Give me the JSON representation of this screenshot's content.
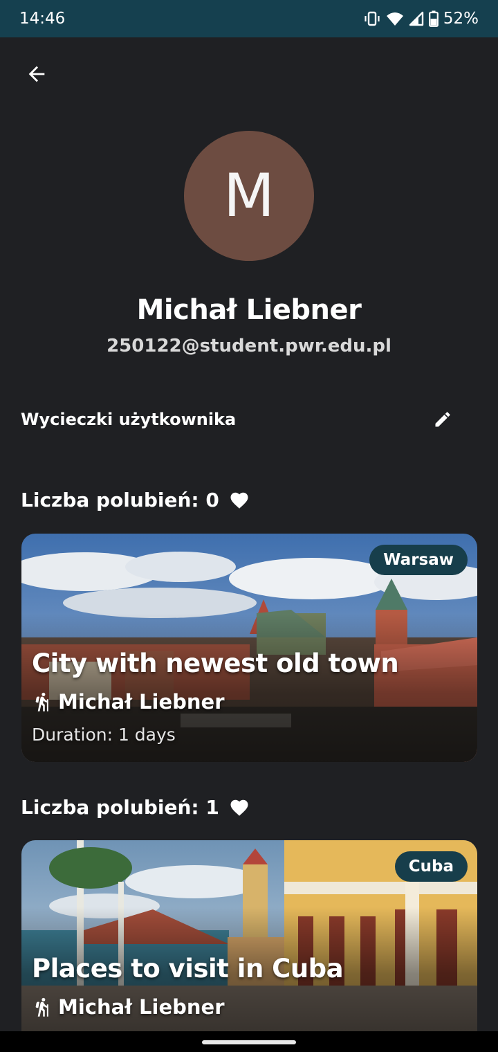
{
  "status_bar": {
    "time": "14:46",
    "battery": "52%"
  },
  "icons": {
    "back": "arrow-back-icon",
    "edit": "pencil-icon",
    "heart": "heart-icon",
    "hiker": "hiking-icon"
  },
  "profile": {
    "avatar_letter": "M",
    "avatar_color": "#6d4c41",
    "name": "Michał Liebner",
    "email": "250122@student.pwr.edu.pl"
  },
  "section": {
    "title": "Wycieczki użytkownika"
  },
  "trips": [
    {
      "likes_label": "Liczba polubień: 0",
      "city": "Warsaw",
      "title": "City with newest old town",
      "author": "Michał Liebner",
      "duration": "Duration: 1 days"
    },
    {
      "likes_label": "Liczba polubień: 1",
      "city": "Cuba",
      "title": "Places to visit in Cuba",
      "author": "Michał Liebner"
    }
  ],
  "colors": {
    "background": "#1f2023",
    "status_bar": "#15404f",
    "badge": "#173e4b"
  }
}
